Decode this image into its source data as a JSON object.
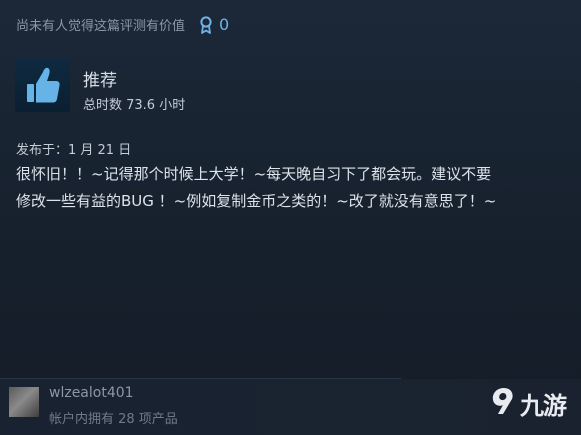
{
  "review": {
    "helpful_text": "尚未有人觉得这篇评测有价值",
    "award_count": "0",
    "verdict": "推荐",
    "hours": "总时数 73.6 小时",
    "posted": "发布于：1 月 21 日",
    "body_line1": "很怀旧！！~记得那个时候上大学！~每天晚自习下了都会玩。建议不要",
    "body_line2": "修改一些有益的BUG ！~例如复制金币之类的！~改了就没有意思了！~"
  },
  "author": {
    "username": "wlzealot401",
    "products": "帐户内拥有 28 项产品"
  },
  "watermark": {
    "text": "九游"
  },
  "colors": {
    "accent": "#6fb3e6",
    "thumb": "#66b3e8",
    "background": "#16202d"
  },
  "icons": {
    "award": "award-icon",
    "thumbs_up": "thumbs-up-icon"
  }
}
